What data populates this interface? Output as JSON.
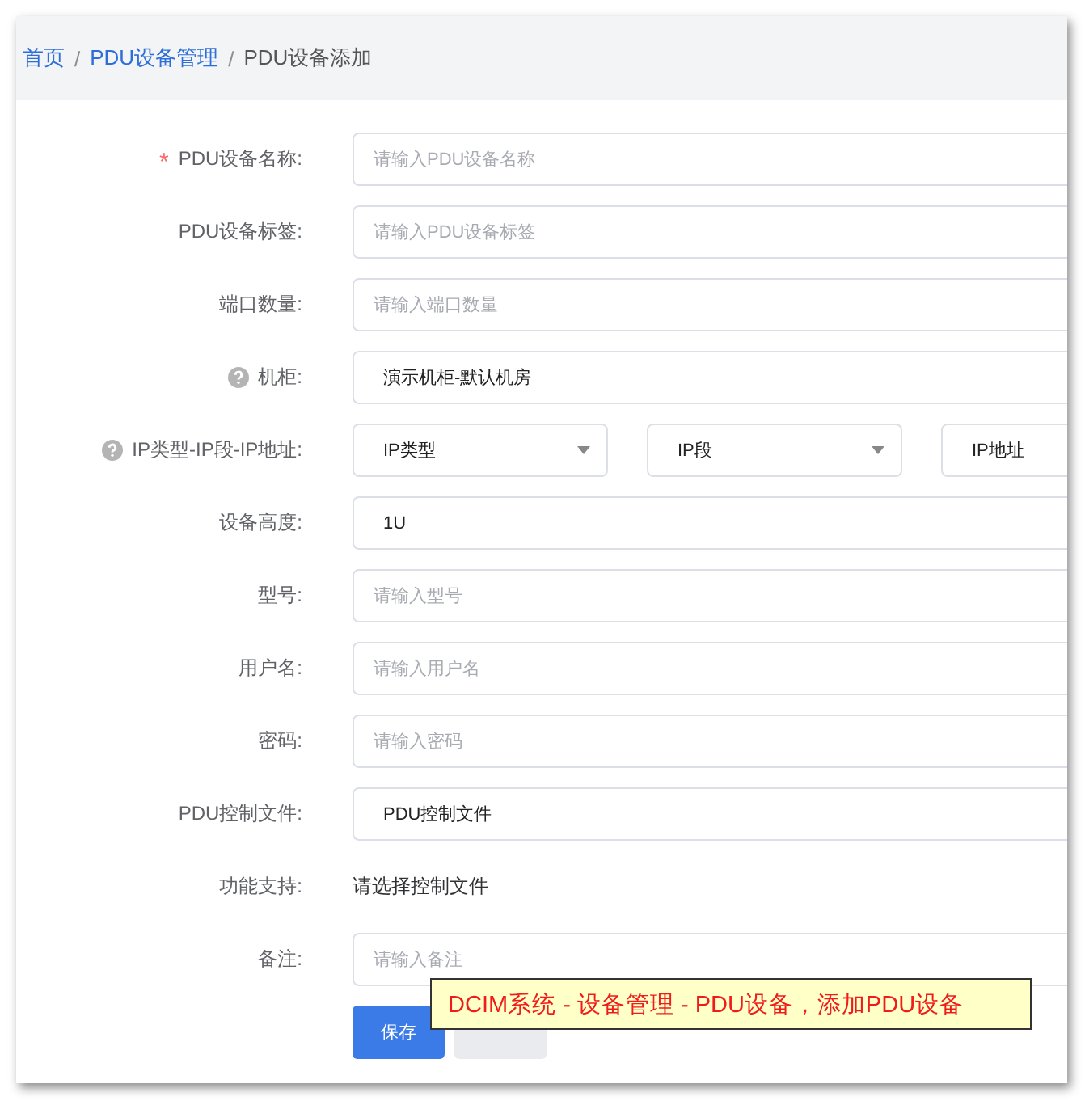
{
  "breadcrumb": [
    {
      "label": "首页",
      "link": true
    },
    {
      "label": "PDU设备管理",
      "link": true
    },
    {
      "label": "PDU设备添加",
      "link": false
    }
  ],
  "breadcrumb_separator": "/",
  "form": [
    {
      "label": "PDU设备名称:",
      "required": true,
      "help": false,
      "kind": "input",
      "placeholder": "请输入PDU设备名称"
    },
    {
      "label": "PDU设备标签:",
      "required": false,
      "help": false,
      "kind": "input",
      "placeholder": "请输入PDU设备标签"
    },
    {
      "label": "端口数量:",
      "required": false,
      "help": false,
      "kind": "input",
      "placeholder": "请输入端口数量"
    },
    {
      "label": "机柜:",
      "required": false,
      "help": true,
      "kind": "input",
      "value": "演示机柜-默认机房"
    },
    {
      "label": "IP类型-IP段-IP地址:",
      "required": false,
      "help": true,
      "kind": "selects",
      "options": [
        {
          "value": "IP类型",
          "dropdown": true
        },
        {
          "value": "IP段",
          "dropdown": true
        },
        {
          "value": "IP地址"
        }
      ]
    },
    {
      "label": "设备高度:",
      "required": false,
      "help": false,
      "kind": "input",
      "value": "1U"
    },
    {
      "label": "型号:",
      "required": false,
      "help": false,
      "kind": "input",
      "placeholder": "请输入型号"
    },
    {
      "label": "用户名:",
      "required": false,
      "help": false,
      "kind": "input",
      "placeholder": "请输入用户名"
    },
    {
      "label": "密码:",
      "required": false,
      "help": false,
      "kind": "input",
      "placeholder": "请输入密码"
    },
    {
      "label": "PDU控制文件:",
      "required": false,
      "help": false,
      "kind": "input",
      "value": "PDU控制文件"
    },
    {
      "label": "功能支持:",
      "required": false,
      "help": false,
      "kind": "text",
      "value": "请选择控制文件"
    },
    {
      "label": "备注:",
      "required": false,
      "help": false,
      "kind": "input",
      "placeholder": "请输入备注"
    }
  ],
  "required_mark": "*",
  "buttons": [
    {
      "label": "保存",
      "primary": true
    },
    {
      "primary": false
    }
  ],
  "caption": "DCIM系统 - 设备管理 - PDU设备，添加PDU设备"
}
